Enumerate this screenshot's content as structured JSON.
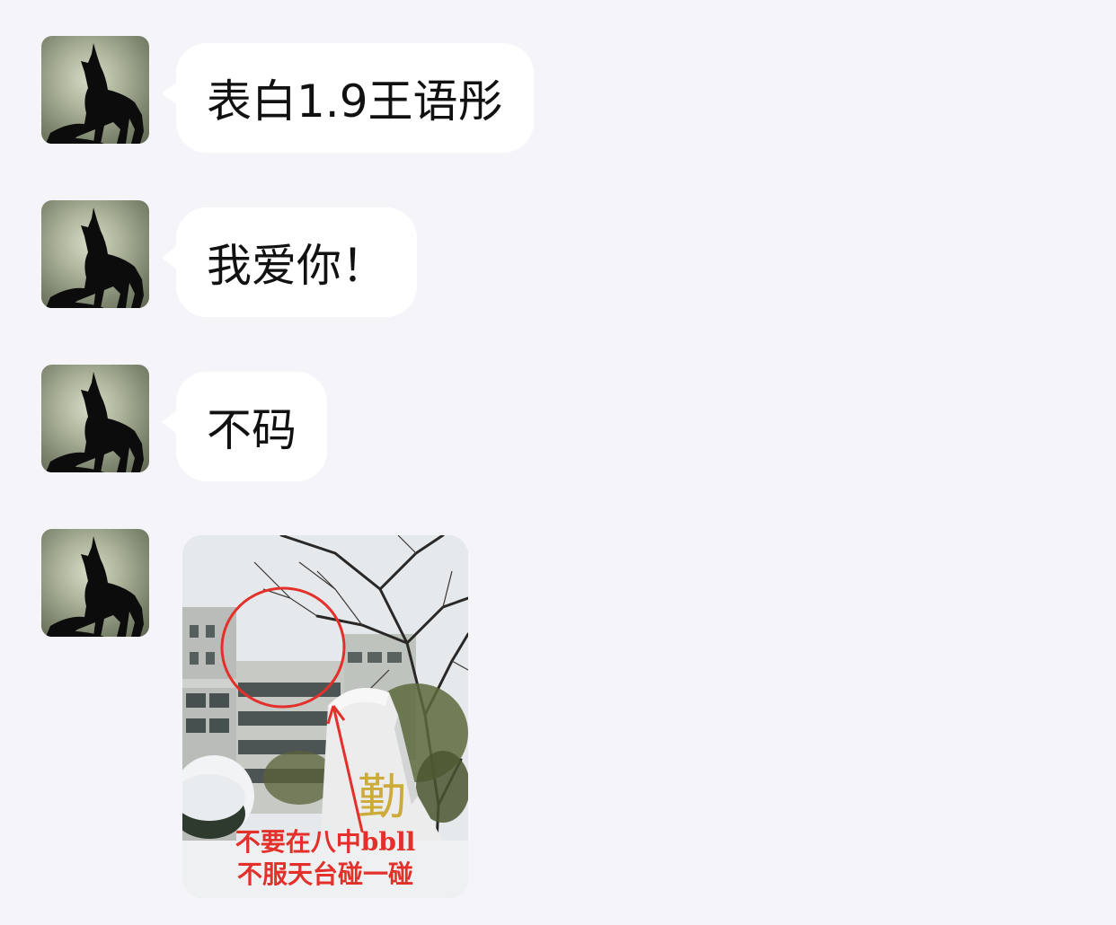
{
  "messages": [
    {
      "type": "text",
      "text": "表白1.9王语彤"
    },
    {
      "type": "text",
      "text": "我爱你！"
    },
    {
      "type": "text",
      "text": "不码"
    },
    {
      "type": "image",
      "image": {
        "description_icon": "snowy-campus-photo",
        "caption_line1": "不要在八中bbll",
        "caption_line2": "不服天台碰一碰",
        "rock_inscription": "勤"
      }
    }
  ],
  "avatar": {
    "icon": "howling-wolf-avatar"
  },
  "colors": {
    "background": "#f4f4f9",
    "bubble": "#ffffff",
    "annotation_red": "#e3302a"
  }
}
